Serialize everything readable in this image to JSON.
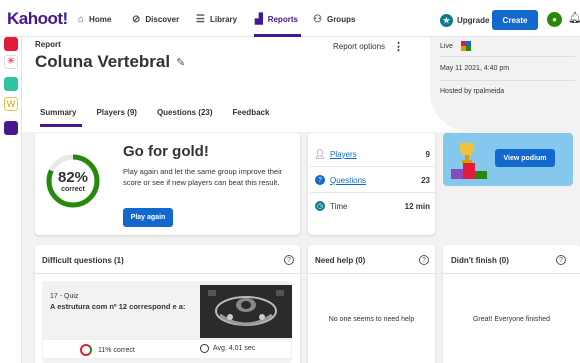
{
  "nav": {
    "logo": "Kahoot!",
    "items": [
      {
        "label": "Home",
        "icon": "home-icon"
      },
      {
        "label": "Discover",
        "icon": "compass-icon"
      },
      {
        "label": "Library",
        "icon": "list-icon"
      },
      {
        "label": "Reports",
        "icon": "bar-chart-icon"
      },
      {
        "label": "Groups",
        "icon": "people-icon"
      }
    ],
    "upgrade_label": "Upgrade",
    "create_label": "Create"
  },
  "header": {
    "section": "Report",
    "title": "Coluna Vertebral",
    "options_label": "Report options",
    "status": "Live",
    "date": "May 11 2021, 4:40 pm",
    "host": "Hosted by rpalmeida"
  },
  "tabs": [
    {
      "label": "Summary"
    },
    {
      "label": "Players (9)"
    },
    {
      "label": "Questions (23)"
    },
    {
      "label": "Feedback"
    }
  ],
  "summary": {
    "percent": "82%",
    "percent_value": 0.82,
    "percent_sub": "correct",
    "headline": "Go for gold!",
    "description": "Play again and let the same group improve their score or see if new players can beat this result.",
    "play_again": "Play again"
  },
  "stats": [
    {
      "label": "Players",
      "value": "9",
      "color": "#864cbf"
    },
    {
      "label": "Questions",
      "value": "23",
      "color": "#1368ce"
    },
    {
      "label": "Time",
      "value": "12 min",
      "color": "#0e7a92"
    }
  ],
  "podium": {
    "button": "View podium"
  },
  "difficult": {
    "title": "Difficult questions (1)",
    "question_type": "17 - Quiz",
    "question_text": "A estrutura com nº 12 correspond e a:",
    "correct": "11% correct",
    "avg": "Avg. 4.01 sec"
  },
  "need_help": {
    "title": "Need help (0)",
    "message": "No one seems to need help"
  },
  "didnt_finish": {
    "title": "Didn't finish (0)",
    "message": "Great! Everyone finished"
  },
  "colors": {
    "accent": "#46178f",
    "primary": "#1368ce",
    "green": "#26890c",
    "red": "#e21b3c"
  }
}
